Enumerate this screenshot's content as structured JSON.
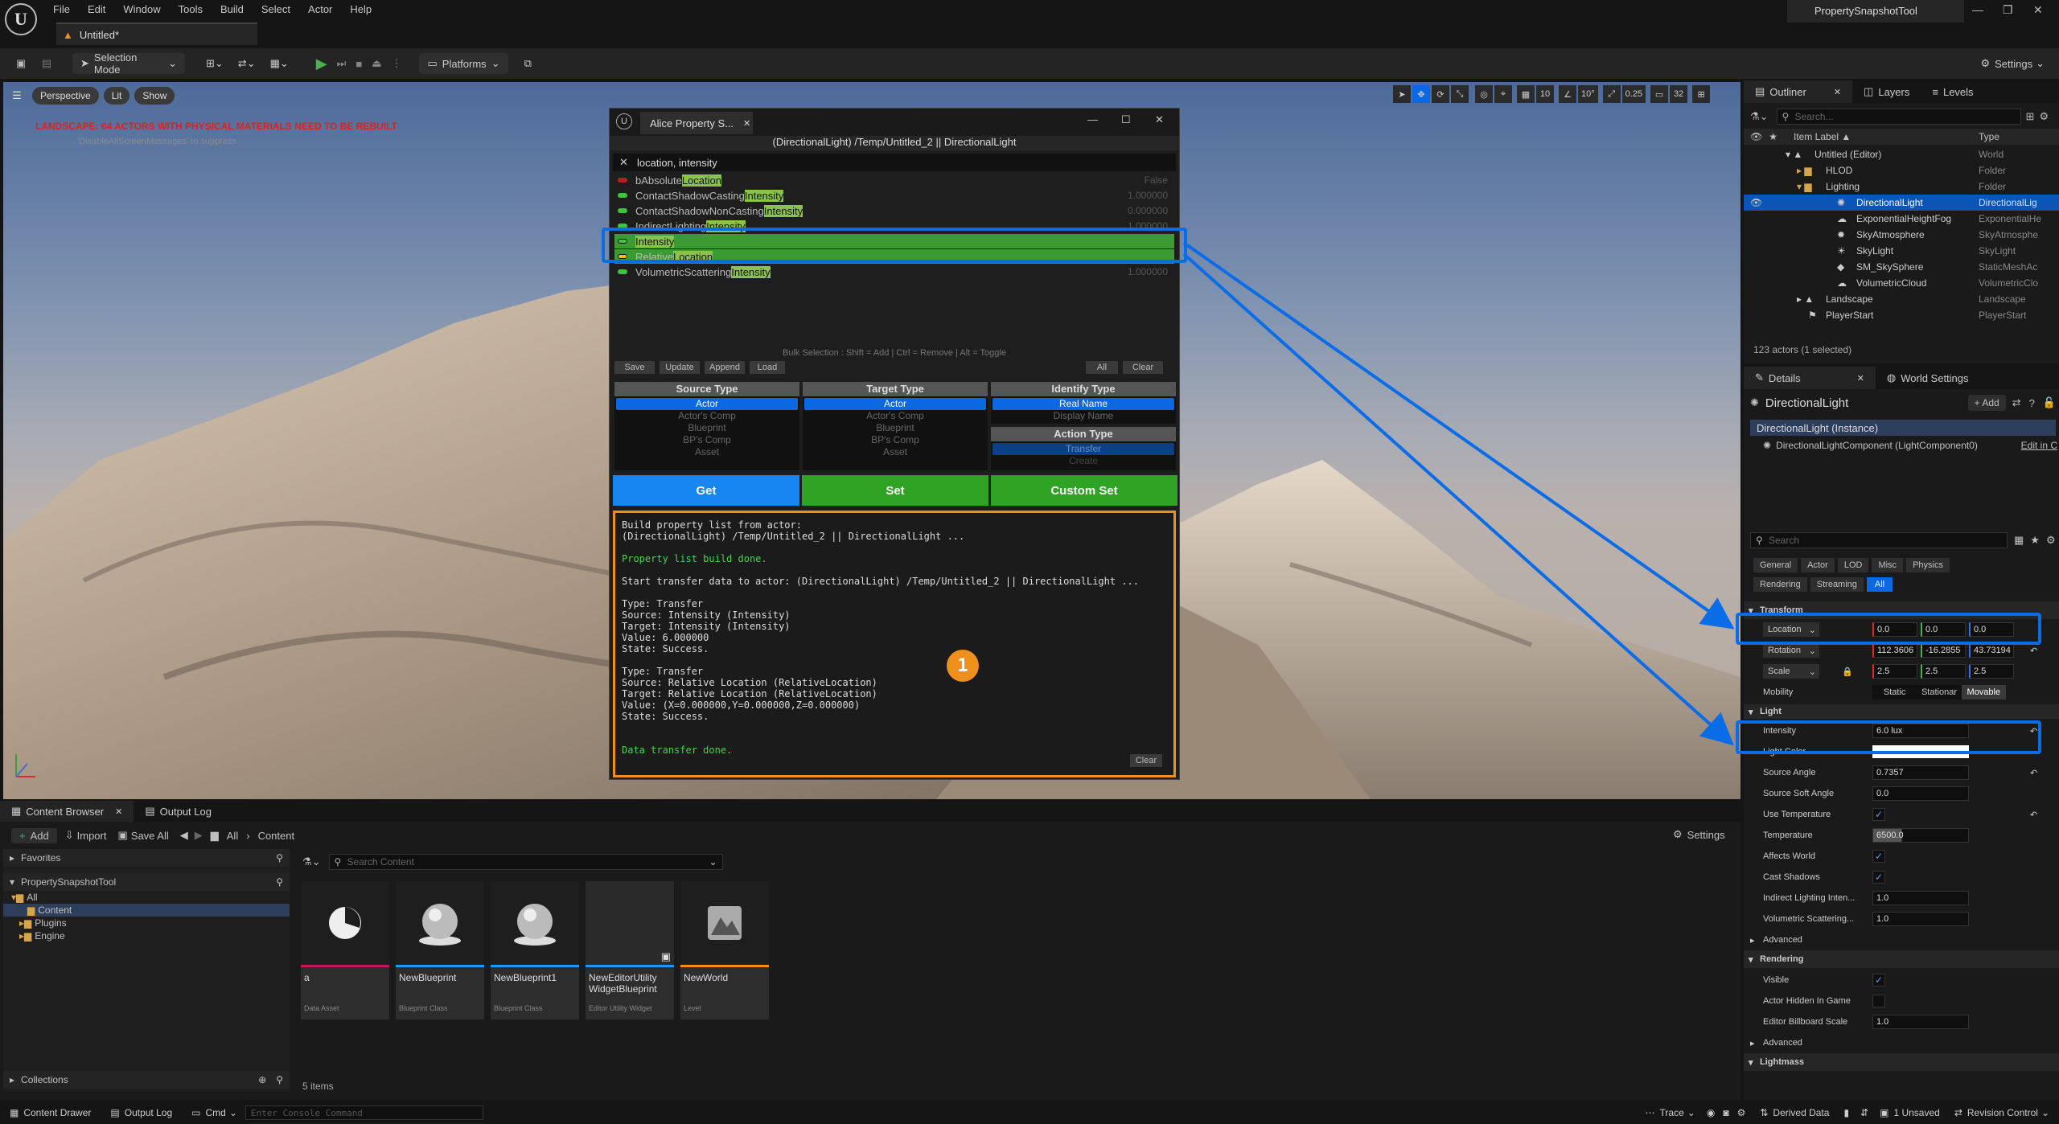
{
  "app": {
    "logo": "U",
    "menus": [
      "File",
      "Edit",
      "Window",
      "Tools",
      "Build",
      "Select",
      "Actor",
      "Help"
    ],
    "doc_tab": "Untitled*",
    "project": "PropertySnapshotTool",
    "window_controls": [
      "—",
      "❐",
      "✕"
    ]
  },
  "toolbar": {
    "selection_mode": "Selection Mode",
    "platforms": "Platforms",
    "settings": "Settings"
  },
  "viewport": {
    "perspective": "Perspective",
    "lit": "Lit",
    "show": "Show",
    "warning": "LANDSCAPE: 64 ACTORS WITH PHYSICAL MATERIALS NEED TO BE REBUILT",
    "warning_sub": "'DisableAllScreenMessages' to suppress",
    "grid": "10",
    "angle": "10°",
    "scale": "0.25",
    "cam_speed": "32"
  },
  "tool": {
    "tab": "Alice Property S...",
    "path": "(DirectionalLight) /Temp/Untitled_2 || DirectionalLight",
    "search": "location, intensity",
    "props": [
      {
        "pre": "bAbsolute",
        "hl": "Location",
        "post": "",
        "value": "False",
        "dot": "#b22222"
      },
      {
        "pre": "ContactShadowCasting",
        "hl": "Intensity",
        "post": "",
        "value": "1.000000",
        "dot": "#3ec43e"
      },
      {
        "pre": "ContactShadowNonCasting",
        "hl": "Intensity",
        "post": "",
        "value": "0.000000",
        "dot": "#3ec43e"
      },
      {
        "pre": "IndirectLighting",
        "hl": "Intensity",
        "post": "",
        "value": "1.000000",
        "dot": "#3ec43e"
      },
      {
        "pre": "",
        "hl": "Intensity",
        "post": "",
        "value": "",
        "dot": "#3ec43e"
      },
      {
        "pre": "Relative",
        "hl": "Location",
        "post": "",
        "value": "",
        "dot": "#e8c020"
      },
      {
        "pre": "VolumetricScattering",
        "hl": "Intensity",
        "post": "",
        "value": "1.000000",
        "dot": "#3ec43e"
      }
    ],
    "bulk_hint": "Bulk Selection : Shift = Add | Ctrl = Remove | Alt = Toggle",
    "btn_save": "Save",
    "btn_update": "Update",
    "btn_append": "Append",
    "btn_load": "Load",
    "btn_all": "All",
    "btn_clear": "Clear",
    "source": {
      "title": "Source Type",
      "options": [
        "Actor",
        "Actor's Comp",
        "Blueprint",
        "BP's Comp",
        "Asset"
      ]
    },
    "target": {
      "title": "Target Type",
      "options": [
        "Actor",
        "Actor's Comp",
        "Blueprint",
        "BP's Comp",
        "Asset"
      ]
    },
    "identify": {
      "title": "Identify Type",
      "options": [
        "Real Name",
        "Display Name"
      ]
    },
    "action": {
      "title": "Action Type",
      "options": [
        "Transfer",
        "Create"
      ]
    },
    "get": "Get",
    "set": "Set",
    "custom_set": "Custom Set",
    "log": [
      {
        "t": "Build property list from actor:",
        "c": "w"
      },
      {
        "t": "(DirectionalLight) /Temp/Untitled_2 || DirectionalLight ...",
        "c": "w"
      },
      {
        "t": "",
        "c": "w"
      },
      {
        "t": "Property list build done.",
        "c": "g"
      },
      {
        "t": "",
        "c": "w"
      },
      {
        "t": "Start transfer data to actor: (DirectionalLight) /Temp/Untitled_2 || DirectionalLight ...",
        "c": "w"
      },
      {
        "t": "",
        "c": "w"
      },
      {
        "t": "Type: Transfer",
        "c": "w"
      },
      {
        "t": "Source: Intensity (Intensity)",
        "c": "w"
      },
      {
        "t": "Target: Intensity (Intensity)",
        "c": "w"
      },
      {
        "t": "Value: 6.000000",
        "c": "w"
      },
      {
        "t": "State: Success.",
        "c": "w"
      },
      {
        "t": "",
        "c": "w"
      },
      {
        "t": "Type: Transfer",
        "c": "w"
      },
      {
        "t": "Source: Relative Location (RelativeLocation)",
        "c": "w"
      },
      {
        "t": "Target: Relative Location (RelativeLocation)",
        "c": "w"
      },
      {
        "t": "Value: (X=0.000000,Y=0.000000,Z=0.000000)",
        "c": "w"
      },
      {
        "t": "State: Success.",
        "c": "w"
      },
      {
        "t": "",
        "c": "w"
      },
      {
        "t": "",
        "c": "w"
      },
      {
        "t": "Data transfer done.",
        "c": "g"
      }
    ],
    "log_clear": "Clear",
    "badge": "1"
  },
  "outliner": {
    "tabs": [
      "Outliner",
      "Layers",
      "Levels"
    ],
    "search_placeholder": "Search...",
    "col_label": "Item Label ▲",
    "col_type": "Type",
    "rows": [
      {
        "label": "Untitled (Editor)",
        "type": "World",
        "indent": 0
      },
      {
        "label": "HLOD",
        "type": "Folder",
        "indent": 1
      },
      {
        "label": "Lighting",
        "type": "Folder",
        "indent": 1
      },
      {
        "label": "DirectionalLight",
        "type": "DirectionalLig",
        "indent": 2,
        "sel": true
      },
      {
        "label": "ExponentialHeightFog",
        "type": "ExponentialHe",
        "indent": 2
      },
      {
        "label": "SkyAtmosphere",
        "type": "SkyAtmosphe",
        "indent": 2
      },
      {
        "label": "SkyLight",
        "type": "SkyLight",
        "indent": 2
      },
      {
        "label": "SM_SkySphere",
        "type": "StaticMeshAc",
        "indent": 2
      },
      {
        "label": "VolumetricCloud",
        "type": "VolumetricClo",
        "indent": 2
      },
      {
        "label": "Landscape",
        "type": "Landscape",
        "indent": 1
      },
      {
        "label": "PlayerStart",
        "type": "PlayerStart",
        "indent": 1
      }
    ],
    "count": "123 actors (1 selected)"
  },
  "details": {
    "tabs": [
      "Details",
      "World Settings"
    ],
    "actor": "DirectionalLight",
    "add": "+ Add",
    "instance": "DirectionalLight (Instance)",
    "component": "DirectionalLightComponent (LightComponent0)",
    "edit_in": "Edit in C",
    "search_placeholder": "Search",
    "filters": [
      "General",
      "Actor",
      "LOD",
      "Misc",
      "Physics",
      "Rendering",
      "Streaming",
      "All"
    ],
    "transform": "Transform",
    "location": {
      "label": "Location",
      "x": "0.0",
      "y": "0.0",
      "z": "0.0"
    },
    "rotation": {
      "label": "Rotation",
      "x": "112.3606",
      "y": "-16.2855",
      "z": "43.73194"
    },
    "scale": {
      "label": "Scale",
      "x": "2.5",
      "y": "2.5",
      "z": "2.5"
    },
    "mobility": {
      "label": "Mobility",
      "opts": [
        "Static",
        "Stationar",
        "Movable"
      ]
    },
    "light": "Light",
    "intensity": {
      "label": "Intensity",
      "value": "6.0 lux"
    },
    "light_color": "Light Color",
    "source_angle": {
      "label": "Source Angle",
      "value": "0.7357"
    },
    "source_soft": {
      "label": "Source Soft Angle",
      "value": "0.0"
    },
    "use_temp": "Use Temperature",
    "temperature": {
      "label": "Temperature",
      "value": "6500.0"
    },
    "affects_world": "Affects World",
    "cast_shadows": "Cast Shadows",
    "indirect": {
      "label": "Indirect Lighting Inten...",
      "value": "1.0"
    },
    "volumetric": {
      "label": "Volumetric Scattering...",
      "value": "1.0"
    },
    "advanced": "Advanced",
    "rendering": "Rendering",
    "visible": "Visible",
    "hidden_game": "Actor Hidden In Game",
    "billboard": {
      "label": "Editor Billboard Scale",
      "value": "1.0"
    },
    "advanced2": "Advanced",
    "lightmass": "Lightmass"
  },
  "content": {
    "tabs": [
      "Content Browser",
      "Output Log"
    ],
    "add": "Add",
    "import": "Import",
    "save_all": "Save All",
    "crumb_all": "All",
    "crumb_content": "Content",
    "settings": "Settings",
    "favorites": "Favorites",
    "project": "PropertySnapshotTool",
    "tree": [
      "All",
      "Content",
      "Plugins",
      "Engine"
    ],
    "search_placeholder": "Search Content",
    "collections": "Collections",
    "items_count": "5 items",
    "assets": [
      {
        "name": "a",
        "kind": "Data Asset",
        "color": "#c2185b"
      },
      {
        "name": "NewBlueprint",
        "kind": "Blueprint Class",
        "color": "#2196f3"
      },
      {
        "name": "NewBlueprint1",
        "kind": "Blueprint Class",
        "color": "#2196f3"
      },
      {
        "name": "NewEditorUtility WidgetBlueprint",
        "kind": "Editor Utility Widget",
        "color": "#2196f3"
      },
      {
        "name": "NewWorld",
        "kind": "Level",
        "color": "#f0901c"
      }
    ]
  },
  "status": {
    "drawer": "Content Drawer",
    "output": "Output Log",
    "cmd": "Cmd",
    "console_placeholder": "Enter Console Command",
    "trace": "Trace",
    "derived": "Derived Data",
    "unsaved": "1 Unsaved",
    "revision": "Revision Control"
  }
}
